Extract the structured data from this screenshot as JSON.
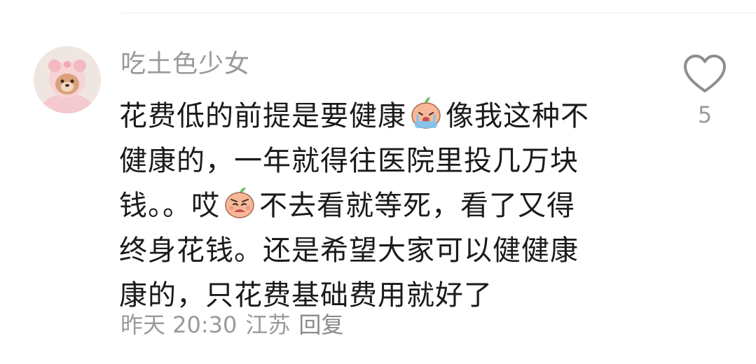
{
  "comment": {
    "username": "吃土色少女",
    "lines": [
      {
        "before": "花费低的前提是要健康",
        "emoji": "crying-emoji",
        "after": "像我这种不"
      },
      {
        "before": "健康的，一年就得往医院里投几万块",
        "emoji": null,
        "after": ""
      },
      {
        "before": "钱。。哎",
        "emoji": "sad-emoji",
        "after": "不去看就等死，看了又得"
      },
      {
        "before": "终身花钱。还是希望大家可以健健康",
        "emoji": null,
        "after": ""
      },
      {
        "before": "康的，只花费基础费用就好了",
        "emoji": null,
        "after": ""
      }
    ],
    "time": "昨天 20:30",
    "location": "江苏",
    "reply_label": "回复"
  },
  "like": {
    "icon": "heart-outline-icon",
    "count": "5"
  },
  "colors": {
    "text_primary": "#1a1a1a",
    "text_secondary": "#9a9a9a",
    "divider": "#ececec",
    "emoji_base": "#f6b897"
  }
}
